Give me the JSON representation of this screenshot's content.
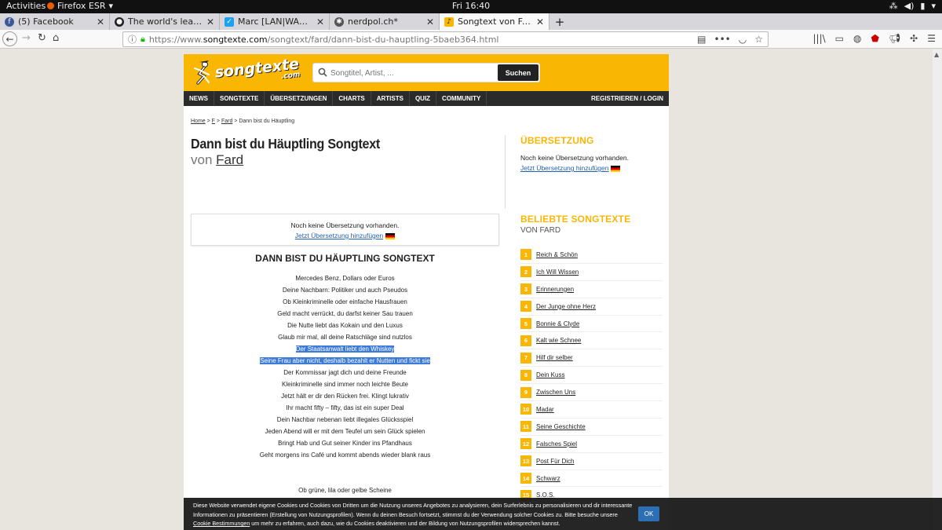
{
  "topbar": {
    "activities": "Activities",
    "app_name": "Firefox ESR",
    "clock": "Fri 16:40"
  },
  "tabs": [
    {
      "label": "(5) Facebook",
      "icon": "facebook-icon",
      "color": "#3b5998"
    },
    {
      "label": "The world's leading softw",
      "icon": "github-icon",
      "color": "#222222"
    },
    {
      "label": "Marc [LAN|WAN]dolt jur",
      "icon": "twitter-icon",
      "color": "#1da1f2"
    },
    {
      "label": "nerdpol.ch*",
      "icon": "nerdpol-icon",
      "color": "#555555"
    },
    {
      "label": "Songtext von Fard – Dann",
      "icon": "songtexte-icon",
      "color": "#f9b602"
    }
  ],
  "new_tab": "+",
  "url": {
    "prefix": "https://www.",
    "host": "songtexte.com",
    "path": "/songtext/fard/dann-bist-du-hauptling-5baeb364.html"
  },
  "site": {
    "logo_text": "songtexte",
    "logo_sub": ".com",
    "search_placeholder": "Songtitel, Artist, ...",
    "search_button": "Suchen",
    "menu": [
      "NEWS",
      "SONGTEXTE",
      "ÜBERSETZUNGEN",
      "CHARTS",
      "ARTISTS",
      "QUIZ",
      "COMMUNITY"
    ],
    "login": "REGISTRIEREN / LOGIN",
    "accent": "#f9b602"
  },
  "breadcrumb": {
    "home": "Home",
    "sep1": " > ",
    "letter": "F",
    "sep2": " > ",
    "artist": "Fard",
    "sep3": " > ",
    "current": "Dann bist du Häuptling"
  },
  "song": {
    "title": "Dann bist du Häuptling Songtext",
    "by_prefix": "von ",
    "artist": "Fard"
  },
  "translation_side": {
    "heading": "ÜBERSETZUNG",
    "none_text": "Noch keine Übersetzung vorhanden.",
    "add_link": "Jetzt Übersetzung hinzufügen"
  },
  "translation_box": {
    "none_text": "Noch keine Übersetzung vorhanden.",
    "add_link": "Jetzt Übersetzung hinzufügen"
  },
  "lyrics": {
    "heading": "DANN BIST DU HÄUPTLING SONGTEXT",
    "lines": [
      "Mercedes Benz, Dollars oder Euros",
      "Deine Nachbarn: Politiker und auch Pseudos",
      "Ob Kleinkriminelle oder einfache Hausfrauen",
      "Geld macht verrückt, du darfst keiner Sau trauen",
      "Die Nutte liebt das Kokain und den Luxus",
      "Glaub mir mal, all deine Ratschläge sind nutzlos",
      "Der Staatsanwalt liebt den Whiskey",
      "Seine Frau aber nicht, deshalb bezahlt er Nutten und fickt sie",
      "Der Kommissar jagt dich und deine Freunde",
      "Kleinkriminelle sind immer noch leichte Beute",
      "Jetzt hält er dir den Rücken frei. Klingt lukrativ",
      "Ihr macht fifty – fifty, das ist ein super Deal",
      "Dein Nachbar nebenan liebt illegales Glücksspiel",
      "Jeden Abend will er mit dem Teufel um sein Glück spielen",
      "Bringt Hab und Gut seiner Kinder ins Pfandhaus",
      "Geht morgens ins Café und kommt abends wieder blank raus"
    ],
    "after_gap": "Ob grüne, lila oder gelbe Scheine"
  },
  "popular": {
    "heading": "BELIEBTE SONGTEXTE",
    "subheading": "VON FARD",
    "items": [
      {
        "num": "1",
        "title": "Reich & Schön"
      },
      {
        "num": "2",
        "title": "Ich Will Wissen"
      },
      {
        "num": "3",
        "title": "Erinnerungen"
      },
      {
        "num": "4",
        "title": "Der Junge ohne Herz"
      },
      {
        "num": "5",
        "title": "Bonnie & Clyde"
      },
      {
        "num": "6",
        "title": "Kalt wie Schnee"
      },
      {
        "num": "7",
        "title": "Hilf dir selber"
      },
      {
        "num": "8",
        "title": "Dein Kuss"
      },
      {
        "num": "9",
        "title": "Zwischen Uns"
      },
      {
        "num": "10",
        "title": "Madar"
      },
      {
        "num": "11",
        "title": "Seine Geschichte"
      },
      {
        "num": "12",
        "title": "Falsches Spiel"
      },
      {
        "num": "13",
        "title": "Post Für Dich"
      },
      {
        "num": "14",
        "title": "Schwarz"
      },
      {
        "num": "15",
        "title": "S.O.S."
      }
    ]
  },
  "cookie": {
    "text_before": "Diese Website verwendet eigene Cookies und Cookies von Dritten um die Nutzung unseres Angebotes zu analysieren, dein Surferlebnis zu personalisieren und dir interessante Informationen zu präsentieren (Erstellung von Nutzungsprofilen). Wenn du deinen Besuch fortsetzt, stimmst du der Verwendung solcher Cookies zu. Bitte besuche unsere ",
    "link": "Cookie Bestimmungen",
    "text_after": " um mehr zu erfahren, auch dazu, wie du Cookies deaktivieren und der Bildung von Nutzungsprofilen widersprechen kannst.",
    "ok": "OK"
  }
}
